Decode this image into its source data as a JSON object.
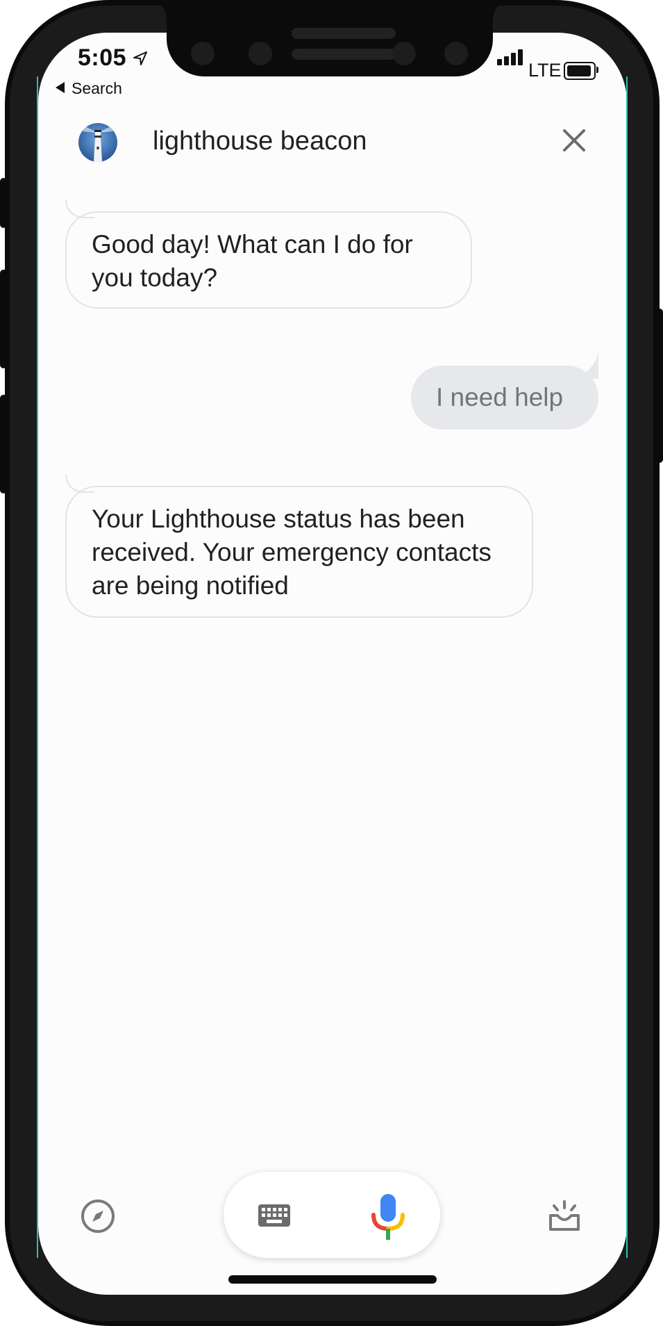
{
  "status_bar": {
    "time": "5:05",
    "back_label": "Search",
    "network": "LTE"
  },
  "header": {
    "title": "lighthouse beacon"
  },
  "conversation": [
    {
      "from": "assistant",
      "text": "Good day! What can I do for you today?"
    },
    {
      "from": "user",
      "text": "I need help"
    },
    {
      "from": "assistant",
      "text": "Your Lighthouse status has been received. Your emergency contacts are being notified"
    }
  ],
  "bottom_bar": {
    "icons": [
      "compass-icon",
      "keyboard-icon",
      "mic-icon",
      "updates-icon"
    ]
  },
  "colors": {
    "screen_bg": "#fcfcfc",
    "user_bubble": "#e7e8eb",
    "mic_blue": "#4285f4",
    "mic_red": "#ea4335",
    "mic_yellow": "#fbbc05",
    "mic_green": "#34a853"
  }
}
